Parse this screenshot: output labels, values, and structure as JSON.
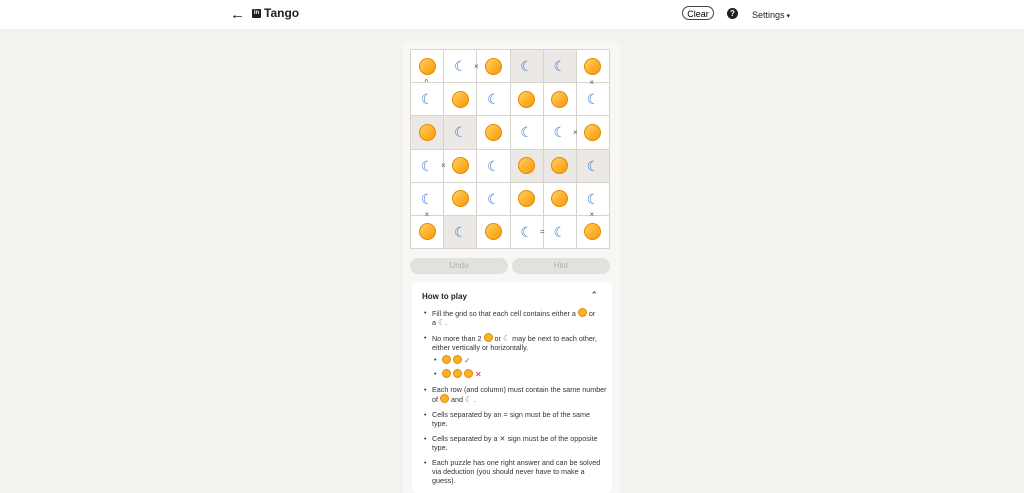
{
  "header": {
    "title": "Tango",
    "logo_text": "in",
    "back_glyph": "←",
    "clear_label": "Clear",
    "help_glyph": "?",
    "settings_label": "Settings",
    "settings_caret": "▾"
  },
  "board": {
    "rows": [
      [
        "sun",
        "moon",
        "sun",
        "moon",
        "moon",
        "sun"
      ],
      [
        "moon",
        "sun",
        "moon",
        "sun",
        "sun",
        "moon"
      ],
      [
        "sun",
        "moon",
        "sun",
        "moon",
        "moon",
        "sun"
      ],
      [
        "moon",
        "sun",
        "moon",
        "sun",
        "sun",
        "moon"
      ],
      [
        "moon",
        "sun",
        "moon",
        "sun",
        "sun",
        "moon"
      ],
      [
        "sun",
        "moon",
        "sun",
        "moon",
        "moon",
        "sun"
      ]
    ],
    "locked": [
      [
        false,
        false,
        false,
        true,
        true,
        false
      ],
      [
        false,
        false,
        false,
        false,
        false,
        false
      ],
      [
        true,
        true,
        false,
        false,
        false,
        false
      ],
      [
        false,
        false,
        false,
        true,
        true,
        true
      ],
      [
        false,
        false,
        false,
        false,
        false,
        false
      ],
      [
        false,
        true,
        false,
        false,
        false,
        false
      ]
    ]
  },
  "constraints": [
    {
      "symbol": "×",
      "row": 1,
      "col": 2,
      "dir": "h"
    },
    {
      "symbol": "^",
      "row": 1,
      "col": 1,
      "dir": "v"
    },
    {
      "symbol": "×",
      "row": 1,
      "col": 6,
      "dir": "v"
    },
    {
      "symbol": "×",
      "row": 3,
      "col": 5,
      "dir": "h"
    },
    {
      "symbol": "×",
      "row": 4,
      "col": 1,
      "dir": "h"
    },
    {
      "symbol": "×",
      "row": 5,
      "col": 1,
      "dir": "v"
    },
    {
      "symbol": "×",
      "row": 5,
      "col": 6,
      "dir": "v"
    },
    {
      "symbol": "=",
      "row": 6,
      "col": 4,
      "dir": "h"
    }
  ],
  "buttons": {
    "undo_label": "Undo",
    "hint_label": "Hint"
  },
  "how_to": {
    "title": "How to play",
    "collapse_glyph": "⌃",
    "rule1_a": "Fill the grid so that each cell contains either a",
    "rule1_b": "or",
    "rule1_c": "a",
    "rule1_d": ".",
    "rule2_a": "No more than 2",
    "rule2_b": "or",
    "rule2_c": "may be next to each other, either vertically or horizontally.",
    "check_glyph": "✓",
    "cross_glyph": "✕",
    "rule3_a": "Each row (and column) must contain the same number of",
    "rule3_b": "and",
    "rule3_c": ".",
    "rule4": "Cells separated by an = sign must be of the same type.",
    "rule5_a": "Cells separated by a",
    "rule5_sym": "✕",
    "rule5_b": "sign must be of the opposite type.",
    "rule6": "Each puzzle has one right answer and can be solved via deduction (you should never have to make a guess)."
  }
}
